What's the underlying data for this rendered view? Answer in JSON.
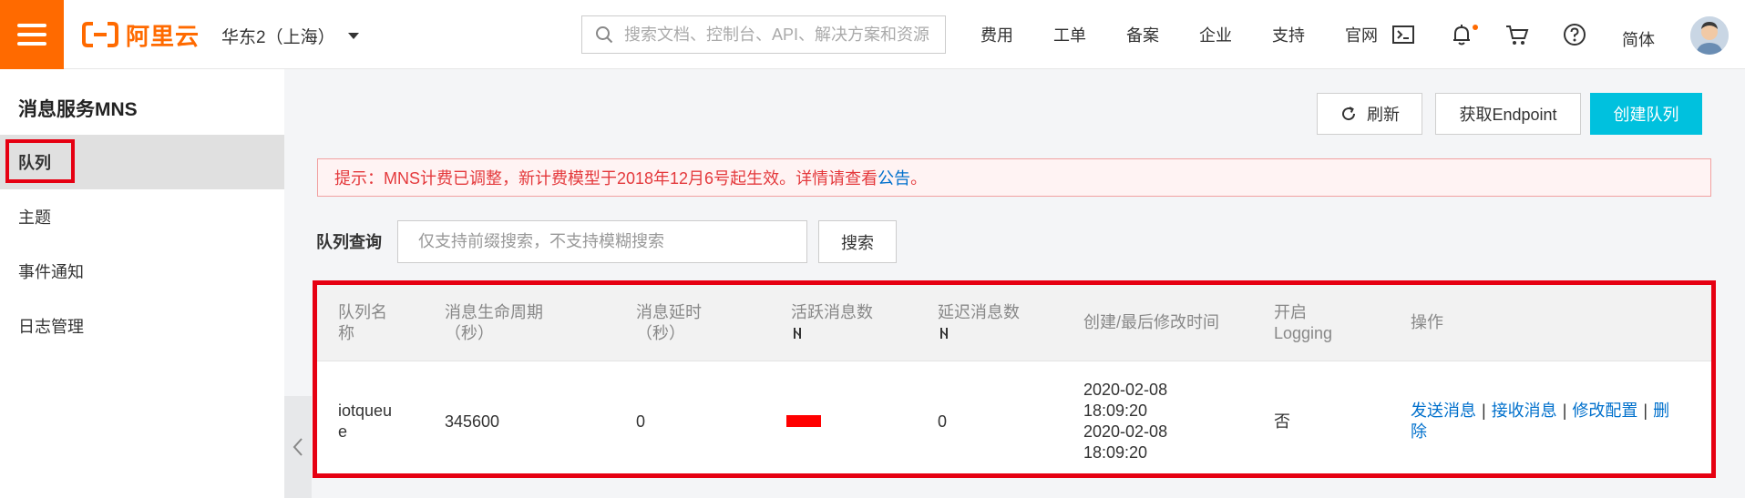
{
  "header": {
    "logo_text": "阿里云",
    "region": "华东2（上海）",
    "search_placeholder": "搜索文档、控制台、API、解决方案和资源",
    "nav_links": [
      "费用",
      "工单",
      "备案",
      "企业",
      "支持",
      "官网"
    ],
    "icons": [
      "terminal-icon",
      "bell-icon",
      "cart-icon",
      "help-icon"
    ],
    "language": "简体",
    "brand_color": "#ff6a00"
  },
  "sidebar": {
    "title": "消息服务MNS",
    "items": [
      {
        "label": "队列",
        "active": true
      },
      {
        "label": "主题",
        "active": false
      },
      {
        "label": "事件通知",
        "active": false
      },
      {
        "label": "日志管理",
        "active": false
      }
    ]
  },
  "toolbar": {
    "refresh_label": "刷新",
    "endpoint_label": "获取Endpoint",
    "create_label": "创建队列"
  },
  "notice": {
    "text": "提示：MNS计费已调整，新计费模型于2018年12月6号起生效。详情请查看",
    "link": "公告",
    "suffix": "。"
  },
  "query": {
    "label": "队列查询",
    "placeholder": "仅支持前缀搜索，不支持模糊搜索",
    "button": "搜索"
  },
  "table": {
    "headers": {
      "name": [
        "队列名",
        "称"
      ],
      "lifetime": [
        "消息生命周期",
        "（秒）"
      ],
      "delay": [
        "消息延时",
        "（秒）"
      ],
      "active": "活跃消息数",
      "delayed": "延迟消息数",
      "time": "创建/最后修改时间",
      "logging": [
        "开启",
        "Logging"
      ],
      "ops": "操作"
    },
    "rows": [
      {
        "name": [
          "iotqueu",
          "e"
        ],
        "lifetime": "345600",
        "delay": "0",
        "delayed": "0",
        "created": [
          "2020-02-08",
          "18:09:20"
        ],
        "modified": [
          "2020-02-08",
          "18:09:20"
        ],
        "logging": "否",
        "ops": {
          "send": "发送消息",
          "receive": "接收消息",
          "modify": "修改配置",
          "delete": [
            "删",
            "除"
          ],
          "sep": "|"
        }
      }
    ]
  },
  "colors": {
    "accent": "#00c1de",
    "highlight_box": "#e60012",
    "link": "#0070cc",
    "notice_text": "#e4393c"
  }
}
